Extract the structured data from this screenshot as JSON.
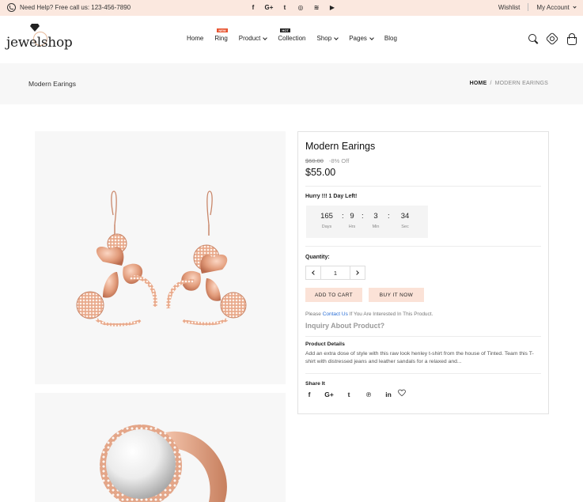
{
  "topbar": {
    "help_text": "Need Help? Free call us: 123-456-7890",
    "social_icons": [
      "facebook-icon",
      "google-plus-icon",
      "twitter-icon",
      "instagram-icon",
      "rss-icon",
      "youtube-icon"
    ],
    "social_glyphs": [
      "f",
      "G+",
      "t",
      "◎",
      "≋",
      "▶"
    ],
    "wishlist": "Wishlist",
    "account": "My Account"
  },
  "header": {
    "logo_text": "jewelshop",
    "nav": [
      {
        "label": "Home",
        "dropdown": false,
        "badge": ""
      },
      {
        "label": "Ring",
        "dropdown": false,
        "badge": "NEW"
      },
      {
        "label": "Product",
        "dropdown": true,
        "badge": ""
      },
      {
        "label": "Collection",
        "dropdown": false,
        "badge": "HOT"
      },
      {
        "label": "Shop",
        "dropdown": true,
        "badge": ""
      },
      {
        "label": "Pages",
        "dropdown": true,
        "badge": ""
      },
      {
        "label": "Blog",
        "dropdown": false,
        "badge": ""
      }
    ],
    "badge_colors": {
      "NEW": "#e8532f",
      "HOT": "#222222"
    }
  },
  "breadcrumb": {
    "page_title": "Modern Earings",
    "home": "HOME",
    "separator": "/",
    "current": "MODERN EARINGS"
  },
  "product": {
    "title": "Modern Earings",
    "old_price": "$60.00",
    "discount": "-8% Off",
    "price": "$55.00",
    "hurry": "Hurry !!! 1 Day Left!",
    "countdown": [
      {
        "value": "165",
        "label": "Days"
      },
      {
        "value": "9",
        "label": "Hrs"
      },
      {
        "value": "3",
        "label": "Min"
      },
      {
        "value": "34",
        "label": "Sec"
      }
    ],
    "countdown_colon": ":",
    "quantity_label": "Quantity:",
    "quantity_value": "1",
    "add_to_cart": "ADD TO CART",
    "buy_now": "BUY IT NOW",
    "contact_prefix": "Please",
    "contact_link": "Contact Us",
    "contact_suffix": "If You Are Interested In This Product.",
    "inquiry": "Inquiry About Product?",
    "details_title": "Product Details",
    "details_text": "Add an extra dose of style with this raw look henley t-shirt from the house of Tinted. Team this T-shirt with distressed jeans and leather sandals for a relaxed and...",
    "share_title": "Share It",
    "share_icons": [
      "facebook-icon",
      "google-plus-icon",
      "twitter-icon",
      "pinterest-icon",
      "linkedin-icon"
    ],
    "share_glyphs": [
      "f",
      "G+",
      "t",
      "℗",
      "in"
    ]
  },
  "colors": {
    "topbar_bg": "#fbe8df",
    "button_bg": "#fbe2d7",
    "rose_gold": "#e3a080",
    "link_blue": "#2b6fd6"
  }
}
